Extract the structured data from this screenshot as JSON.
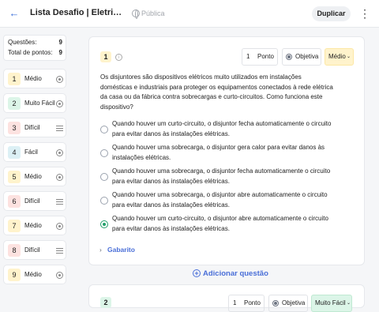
{
  "topbar": {
    "title": "Lista Desafio | Eletricidade:...",
    "visibility": "Pública",
    "duplicate_label": "Duplicar"
  },
  "stats": {
    "questions_label": "Questões:",
    "questions_value": "9",
    "points_label": "Total de pontos:",
    "points_value": "9"
  },
  "sidebar": {
    "items": [
      {
        "number": "1",
        "label": "Médio",
        "icon": "radio-icon",
        "color": "#fff3cc"
      },
      {
        "number": "2",
        "label": "Muito Fácil",
        "icon": "radio-icon",
        "color": "#dcf5e8"
      },
      {
        "number": "3",
        "label": "Difícil",
        "icon": "list-icon",
        "color": "#fde2e0"
      },
      {
        "number": "4",
        "label": "Fácil",
        "icon": "radio-icon",
        "color": "#dcf0f5"
      },
      {
        "number": "5",
        "label": "Médio",
        "icon": "radio-icon",
        "color": "#fff3cc"
      },
      {
        "number": "6",
        "label": "Difícil",
        "icon": "list-icon",
        "color": "#fde2e0"
      },
      {
        "number": "7",
        "label": "Médio",
        "icon": "radio-icon",
        "color": "#fff3cc"
      },
      {
        "number": "8",
        "label": "Difícil",
        "icon": "list-icon",
        "color": "#fde2e0"
      },
      {
        "number": "9",
        "label": "Médio",
        "icon": "radio-icon",
        "color": "#fff3cc"
      }
    ]
  },
  "question": {
    "number": "1",
    "points_value": "1",
    "points_label": "Ponto",
    "type_label": "Objetiva",
    "difficulty_label": "Médio",
    "text": "Os disjuntores são dispositivos elétricos muito utilizados em instalações domésticas e industriais para proteger os equipamentos conectados à rede elétrica da casa ou da fábrica contra sobrecargas e curto-circuitos. Como funciona este dispositivo?",
    "options": [
      {
        "text": "Quando houver um curto-circuito, o disjuntor fecha automaticamente o circuito para evitar danos às instalações elétricas.",
        "selected": false
      },
      {
        "text": "Quando houver uma sobrecarga, o disjuntor gera calor para evitar danos às instalações elétricas.",
        "selected": false
      },
      {
        "text": "Quando houver uma sobrecarga, o disjuntor fecha automaticamente o circuito para evitar danos às instalações elétricas.",
        "selected": false
      },
      {
        "text": "Quando houver uma sobrecarga, o disjuntor abre automaticamente o circuito para evitar danos às instalações elétricas.",
        "selected": false
      },
      {
        "text": "Quando houver um curto-circuito, o disjuntor abre automaticamente o circuito para evitar danos às instalações elétricas.",
        "selected": true
      }
    ],
    "answer_key_label": "Gabarito"
  },
  "add_question_label": "Adicionar questão",
  "question2": {
    "number": "2",
    "points_value": "1",
    "points_label": "Ponto",
    "type_label": "Objetiva",
    "difficulty_label": "Muito Fácil"
  }
}
